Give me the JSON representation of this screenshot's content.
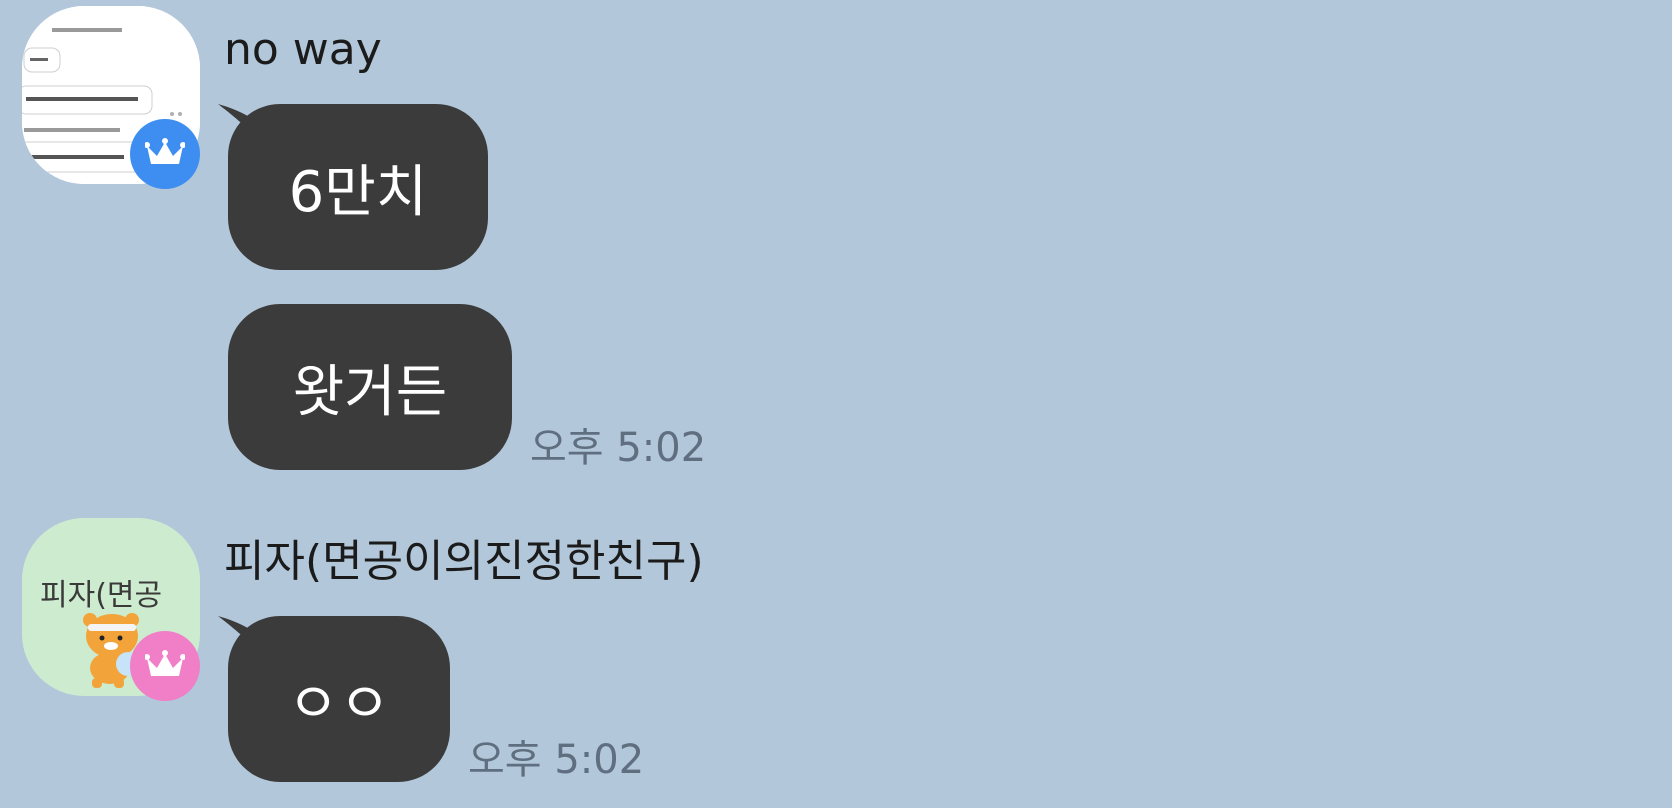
{
  "chat": {
    "group1": {
      "sender": "no way",
      "avatar_icon": "screenshot-thumbnail-avatar",
      "badge_icon": "crown-icon",
      "badge_color": "#3d8ef0",
      "messages": [
        "6만치",
        "왓거든"
      ],
      "time": "오후 5:02"
    },
    "group2": {
      "sender": "피자(면공이의진정한친구)",
      "avatar_text": "피자(면공",
      "avatar_icon": "ryan-character-avatar",
      "badge_icon": "crown-icon",
      "badge_color": "#f07fc7",
      "messages": [
        "ㅇㅇ"
      ],
      "time": "오후 5:02"
    }
  },
  "bubble_color": "#3b3b3b",
  "background_color": "#b2c7da"
}
